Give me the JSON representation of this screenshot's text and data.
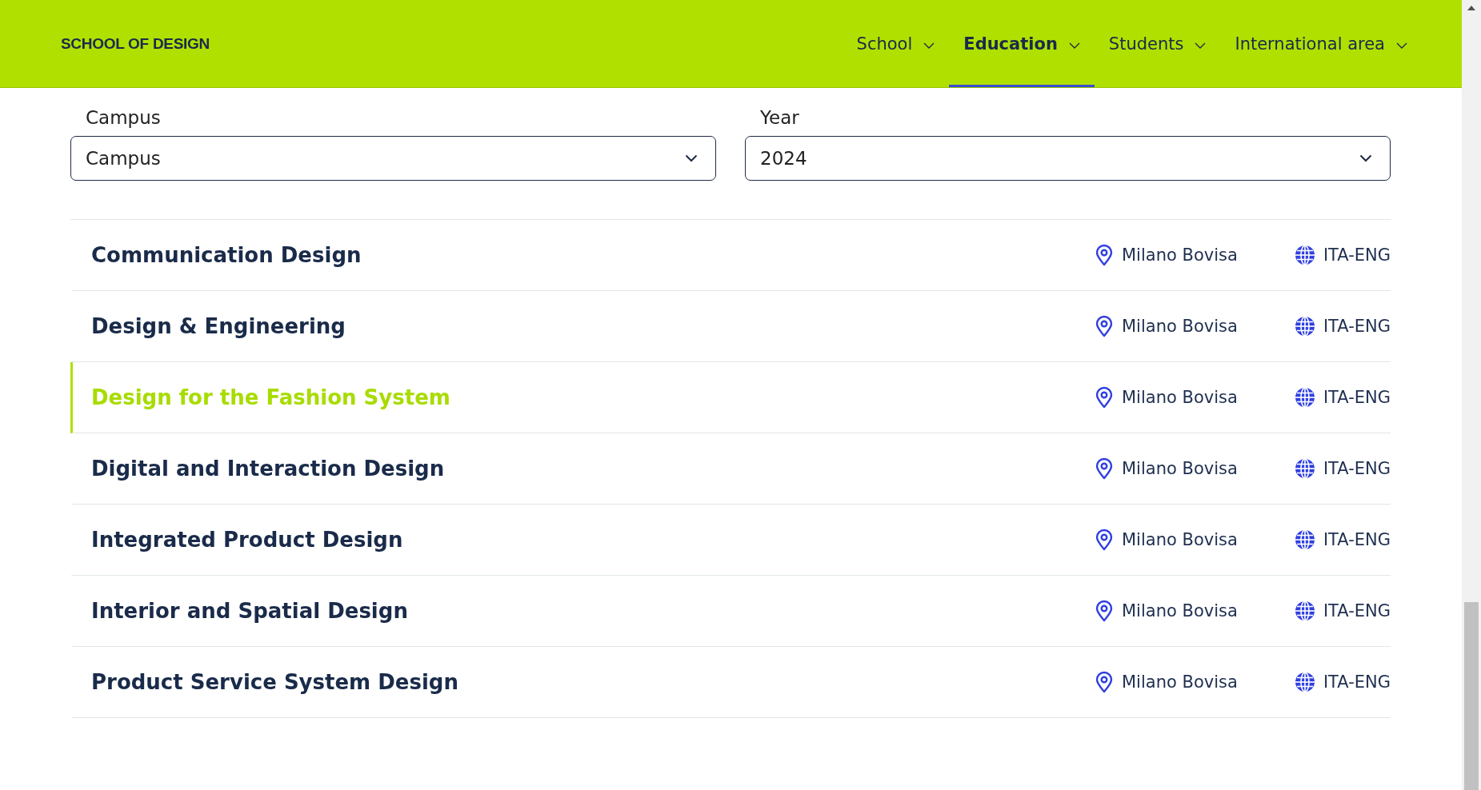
{
  "header": {
    "logo": "SCHOOL OF DESIGN",
    "nav": [
      {
        "label": "School",
        "selected": false
      },
      {
        "label": "Education",
        "selected": true
      },
      {
        "label": "Students",
        "selected": false
      },
      {
        "label": "International area",
        "selected": false
      }
    ]
  },
  "filters": [
    {
      "label": "Campus",
      "value": "Campus"
    },
    {
      "label": "Year",
      "value": "2024"
    }
  ],
  "programmes": [
    {
      "name": "Communication Design",
      "location": "Milano Bovisa",
      "language": "ITA-ENG",
      "selected": false
    },
    {
      "name": "Design & Engineering",
      "location": "Milano Bovisa",
      "language": "ITA-ENG",
      "selected": false
    },
    {
      "name": "Design for the Fashion System",
      "location": "Milano Bovisa",
      "language": "ITA-ENG",
      "selected": true
    },
    {
      "name": "Digital and Interaction Design",
      "location": "Milano Bovisa",
      "language": "ITA-ENG",
      "selected": false
    },
    {
      "name": "Integrated Product Design",
      "location": "Milano Bovisa",
      "language": "ITA-ENG",
      "selected": false
    },
    {
      "name": "Interior and Spatial Design",
      "location": "Milano Bovisa",
      "language": "ITA-ENG",
      "selected": false
    },
    {
      "name": "Product Service System Design",
      "location": "Milano Bovisa",
      "language": "ITA-ENG",
      "selected": false
    }
  ]
}
